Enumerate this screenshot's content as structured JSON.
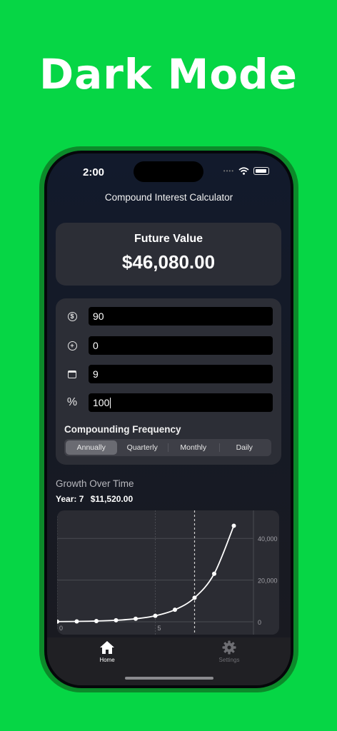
{
  "headline": "Dark Mode",
  "status": {
    "time": "2:00"
  },
  "app_title": "Compound Interest Calculator",
  "future_value": {
    "label": "Future Value",
    "value": "$46,080.00"
  },
  "inputs": {
    "principal": {
      "icon": "dollar-circle-icon",
      "value": "90"
    },
    "contribution": {
      "icon": "plus-circle-icon",
      "value": "0"
    },
    "years": {
      "icon": "calendar-icon",
      "value": "9"
    },
    "rate": {
      "icon": "percent-icon",
      "icon_text": "%",
      "value": "100"
    }
  },
  "frequency": {
    "label": "Compounding Frequency",
    "options": [
      "Annually",
      "Quarterly",
      "Monthly",
      "Daily"
    ],
    "selected": "Annually"
  },
  "growth": {
    "title": "Growth Over Time",
    "selected_year_label": "Year: 7",
    "selected_value": "$11,520.00"
  },
  "chart_data": {
    "type": "line",
    "x": [
      0,
      1,
      2,
      3,
      4,
      5,
      6,
      7,
      8,
      9
    ],
    "series": [
      {
        "values": [
          90,
          180,
          360,
          720,
          1440,
          2880,
          5760,
          11520,
          23040,
          46080
        ]
      }
    ],
    "x_ticks": [
      "0",
      "5"
    ],
    "y_ticks": [
      "0",
      "20,000",
      "40,000"
    ],
    "xlim": [
      0,
      10
    ],
    "ylim": [
      0,
      50000
    ],
    "selected_x": 7,
    "grid": true,
    "axis_position": "right",
    "colors": {
      "line": "#ffffff",
      "grid": "#4a4b52",
      "rule": "#d0d0d0"
    }
  },
  "tabs": [
    {
      "label": "Home",
      "icon": "house-icon",
      "active": true
    },
    {
      "label": "Settings",
      "icon": "gear-icon",
      "active": false
    }
  ],
  "colors": {
    "background": "#06d645",
    "card": "#2c2e36",
    "input": "#000000"
  }
}
